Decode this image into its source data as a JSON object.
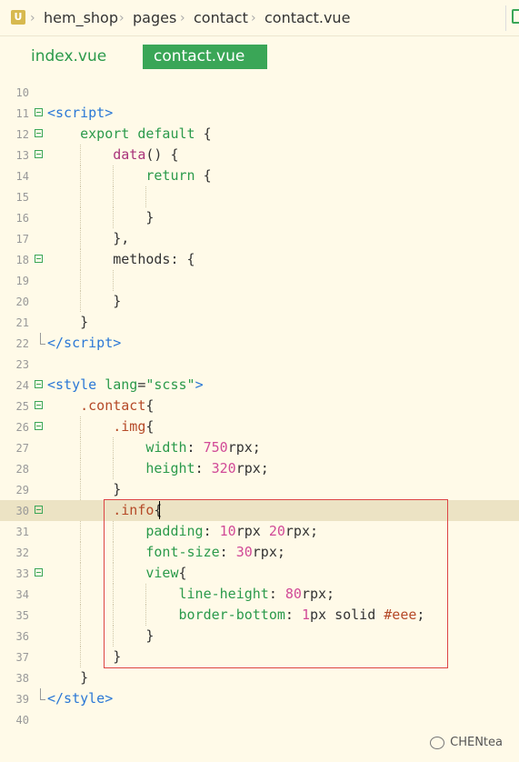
{
  "breadcrumb": {
    "logo": "U",
    "items": [
      "hem_shop",
      "pages",
      "contact",
      "contact.vue"
    ]
  },
  "tabs": [
    {
      "label": "index.vue",
      "active": false
    },
    {
      "label": "contact.vue",
      "active": true
    }
  ],
  "code": {
    "line_numbers": [
      "10",
      "11",
      "12",
      "13",
      "14",
      "15",
      "16",
      "17",
      "18",
      "19",
      "20",
      "21",
      "22",
      "23",
      "24",
      "25",
      "26",
      "27",
      "28",
      "29",
      "30",
      "31",
      "32",
      "33",
      "34",
      "35",
      "36",
      "37",
      "38",
      "39",
      "40"
    ],
    "current_line": "30"
  },
  "watermark": "CHENtea",
  "colors": {
    "accent": "#3aa657",
    "background": "#fffae8",
    "highlight_box": "#dd4444"
  }
}
